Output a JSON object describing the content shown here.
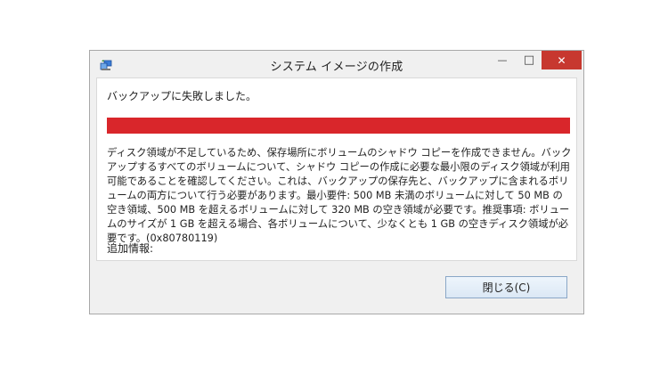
{
  "window": {
    "title": "システム イメージの作成",
    "icon": "backup-app-icon"
  },
  "titlebar_buttons": {
    "minimize_glyph": "—",
    "maximize_glyph": "□",
    "close_glyph": "✕"
  },
  "content": {
    "heading": "バックアップに失敗しました。",
    "progress": {
      "fraction": 1.0,
      "color": "#d9262b"
    },
    "message": "ディスク領域が不足しているため、保存場所にボリュームのシャドウ コピーを作成できません。バックアップするすべてのボリュームについて、シャドウ コピーの作成に必要な最小限のディスク領域が利用可能であることを確認してください。これは、バックアップの保存先と、バックアップに含まれるボリュームの両方について行う必要があります。最小要件: 500 MB 未満のボリュームに対して 50 MB の空き領域、500 MB を超えるボリュームに対して 320 MB の空き領域が必要です。推奨事項: ボリュームのサイズが 1 GB を超える場合、各ボリュームについて、少なくとも 1 GB の空きディスク領域が必要です。(0x80780119)",
    "additional_label": "追加情報:"
  },
  "footer": {
    "close_button_label": "閉じる(C)"
  }
}
